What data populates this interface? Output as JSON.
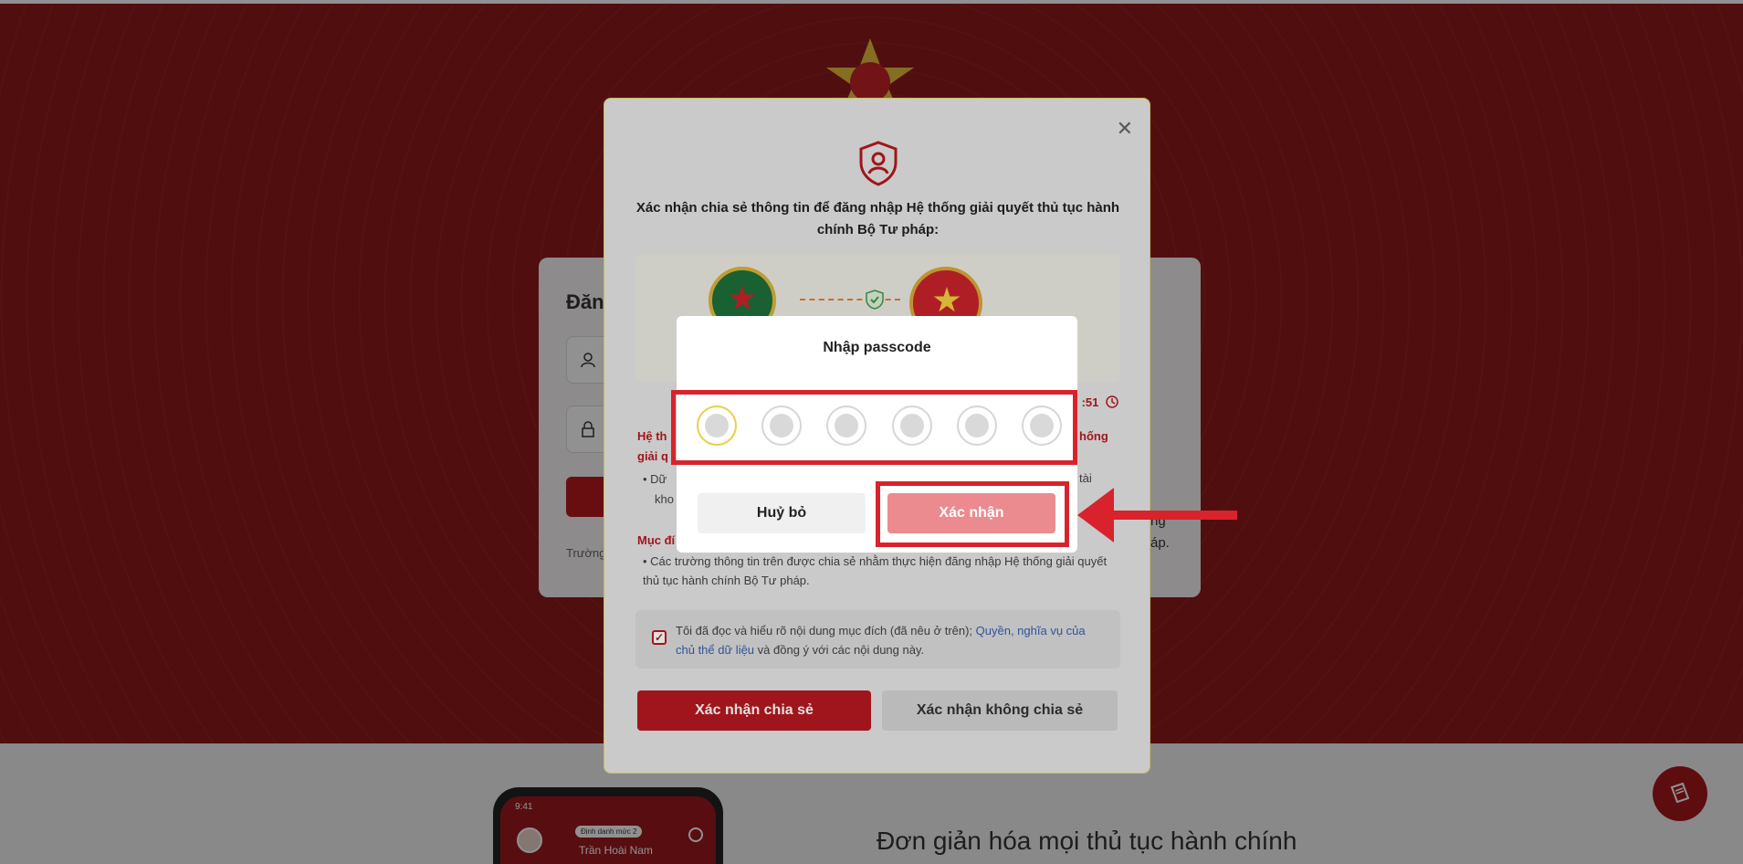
{
  "background": {
    "login_title": "Đăn",
    "login_footer": "Trường",
    "right_text_1": "ng",
    "right_text_2": "áp.",
    "phone_time": "9:41",
    "phone_badge": "Định danh mức 2",
    "phone_name": "Trần Hoài Nam",
    "lower_heading": "Đơn giản hóa mọi thủ tục hành chính"
  },
  "consent": {
    "close_icon": "close-icon",
    "shield_icon": "shield-user-icon",
    "title": "Xác nhận chia sẻ thông tin để đăng nhập Hệ thống giải quyết thủ tục hành chính Bộ Tư pháp:",
    "timer": ":51",
    "section_1_title": "Hệ th",
    "section_1_title_cont": "giải q",
    "section_1_title_right": "hống",
    "section_1_bullet": "• Dữ",
    "section_1_bullet_cont": "kho",
    "section_1_bullet_right": "tài",
    "section_2_title": "Mục đí",
    "section_2_bullet": "• Các trường thông tin trên được chia sẻ nhằm thực hiện đăng nhập Hệ thống giải quyết thủ tục hành chính Bộ Tư pháp.",
    "agree_text_before": "Tôi đã đọc và hiểu rõ nội dung mục đích (đã nêu ở trên); ",
    "agree_link": "Quyền, nghĩa vụ của chủ thể dữ liệu",
    "agree_text_after": " và đồng ý với các nội dung này.",
    "agree_checked": true,
    "share_button": "Xác nhận chia sẻ",
    "noshare_button": "Xác nhận không chia sẻ"
  },
  "passcode": {
    "title": "Nhập passcode",
    "digits": [
      "",
      "",
      "",
      "",
      "",
      ""
    ],
    "cancel_button": "Huỷ bỏ",
    "confirm_button": "Xác nhận"
  },
  "colors": {
    "brand_red": "#b7191f",
    "annotation_red": "#d8232c",
    "confirm_disabled": "#eb8b8f",
    "active_pin_border": "#e6cf4a"
  }
}
